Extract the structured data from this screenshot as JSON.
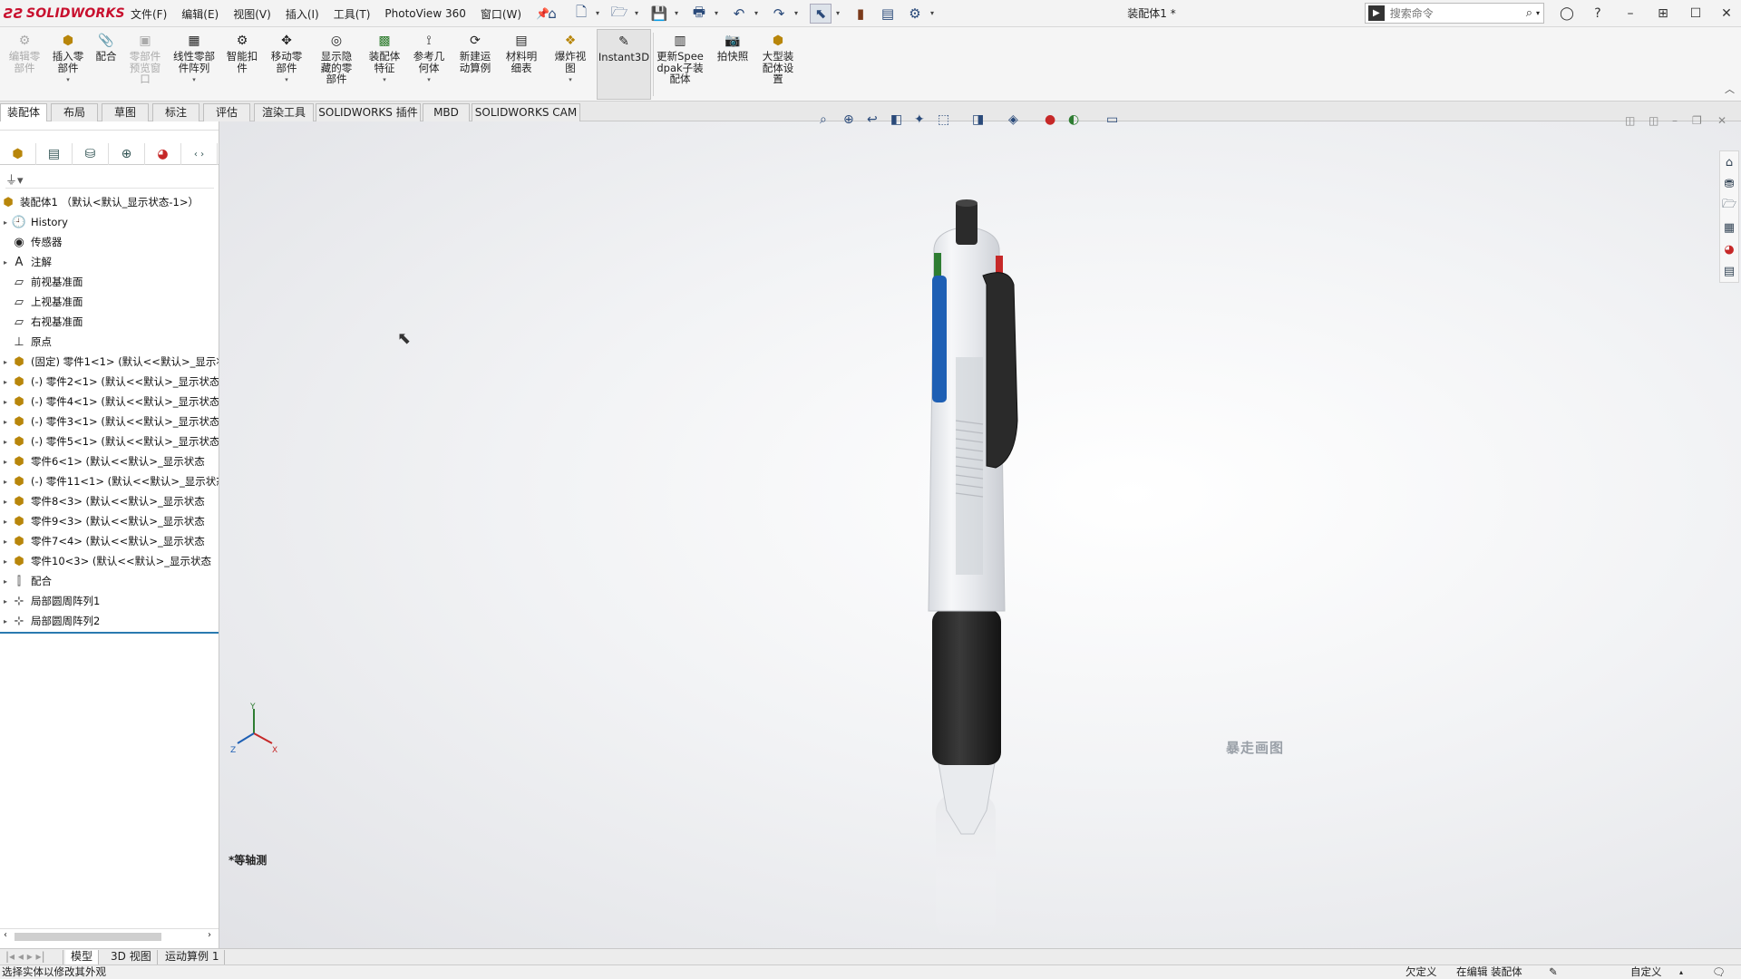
{
  "app": {
    "brand": "SOLIDWORKS",
    "doc_title": "装配体1 *"
  },
  "menu": [
    "文件(F)",
    "编辑(E)",
    "视图(V)",
    "插入(I)",
    "工具(T)",
    "PhotoView 360",
    "窗口(W)"
  ],
  "search": {
    "placeholder": "搜索命令"
  },
  "ribbon": {
    "edit_component": "编辑零部件",
    "insert_component": "插入零部件",
    "mate": "配合",
    "component_preview": "零部件预览窗口",
    "linear_pattern": "线性零部件阵列",
    "smart_fasteners": "智能扣件",
    "move_component": "移动零部件",
    "show_hidden": "显示隐藏的零部件",
    "assembly_features": "装配体特征",
    "reference_geometry": "参考几何体",
    "new_motion_study": "新建运动算例",
    "bom": "材料明细表",
    "exploded_view": "爆炸视图",
    "instant3d": "Instant3D",
    "update_speedpak": "更新Speedpak子装配体",
    "snapshot": "拍快照",
    "large_assembly": "大型装配体设置"
  },
  "tabs": [
    "装配体",
    "布局",
    "草图",
    "标注",
    "评估",
    "渲染工具",
    "SOLIDWORKS 插件",
    "MBD",
    "SOLIDWORKS CAM"
  ],
  "tree": {
    "root": "装配体1 （默认<默认_显示状态-1>）",
    "items": [
      {
        "label": "History",
        "icon": "history-icon",
        "expand": true
      },
      {
        "label": "传感器",
        "icon": "sensor-icon",
        "expand": false
      },
      {
        "label": "注解",
        "icon": "annotation-icon",
        "expand": true
      },
      {
        "label": "前视基准面",
        "icon": "plane-icon",
        "expand": false
      },
      {
        "label": "上视基准面",
        "icon": "plane-icon",
        "expand": false
      },
      {
        "label": "右视基准面",
        "icon": "plane-icon",
        "expand": false
      },
      {
        "label": "原点",
        "icon": "origin-icon",
        "expand": false
      },
      {
        "label": "(固定) 零件1<1> (默认<<默认>_显示状态",
        "icon": "part-icon",
        "expand": true
      },
      {
        "label": "(-) 零件2<1> (默认<<默认>_显示状态",
        "icon": "part-icon",
        "expand": true
      },
      {
        "label": "(-) 零件4<1> (默认<<默认>_显示状态",
        "icon": "part-icon",
        "expand": true
      },
      {
        "label": "(-) 零件3<1> (默认<<默认>_显示状态",
        "icon": "part-icon",
        "expand": true
      },
      {
        "label": "(-) 零件5<1> (默认<<默认>_显示状态",
        "icon": "part-icon",
        "expand": true
      },
      {
        "label": "零件6<1> (默认<<默认>_显示状态",
        "icon": "part-icon",
        "expand": true
      },
      {
        "label": "(-) 零件11<1> (默认<<默认>_显示状态",
        "icon": "part-icon",
        "expand": true
      },
      {
        "label": "零件8<3> (默认<<默认>_显示状态",
        "icon": "part-icon",
        "expand": true
      },
      {
        "label": "零件9<3> (默认<<默认>_显示状态",
        "icon": "part-icon",
        "expand": true
      },
      {
        "label": "零件7<4> (默认<<默认>_显示状态",
        "icon": "part-icon",
        "expand": true
      },
      {
        "label": "零件10<3> (默认<<默认>_显示状态",
        "icon": "part-icon",
        "expand": true
      },
      {
        "label": "配合",
        "icon": "mates-icon",
        "expand": true
      },
      {
        "label": "局部圆周阵列1",
        "icon": "pattern-icon",
        "expand": true
      },
      {
        "label": "局部圆周阵列2",
        "icon": "pattern-icon",
        "expand": true
      }
    ]
  },
  "viewport": {
    "view_label": "*等轴测",
    "watermark": "暴走画图",
    "triad": {
      "x": "X",
      "y": "Y",
      "z": "Z"
    }
  },
  "bottom_tabs": [
    "模型",
    "3D 视图",
    "运动算例 1"
  ],
  "status": {
    "message": "选择实体以修改其外观",
    "state": "欠定义",
    "editing": "在编辑 装配体",
    "units": "自定义"
  }
}
